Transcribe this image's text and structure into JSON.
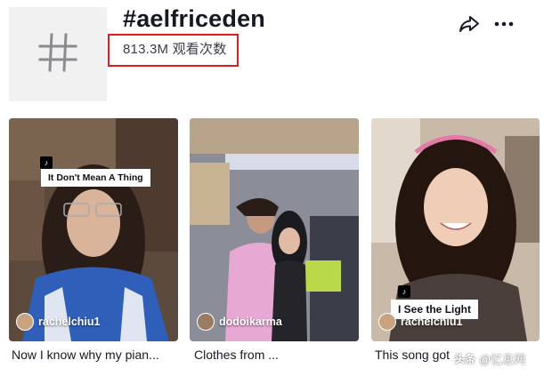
{
  "header": {
    "title": "#aelfriceden",
    "views": "813.3M 观看次数"
  },
  "icons": {
    "hashtag": "hashtag-icon",
    "share": "share-icon",
    "more": "more-icon"
  },
  "videos": [
    {
      "creator": "rachelchiu1",
      "overlay_text": "It Don't Mean A Thing",
      "caption": "Now I know why my pian..."
    },
    {
      "creator": "dodoikarma",
      "caption": "Clothes from ..."
    },
    {
      "creator": "rachelchiu1",
      "overlay_text": "I See the Light",
      "caption": "This song got"
    }
  ],
  "watermark": {
    "prefix": "头条",
    "text": "@忆息网"
  },
  "colors": {
    "highlight_box": "#e01b1b",
    "text_primary": "#161823",
    "text_secondary": "#3b3c44"
  }
}
